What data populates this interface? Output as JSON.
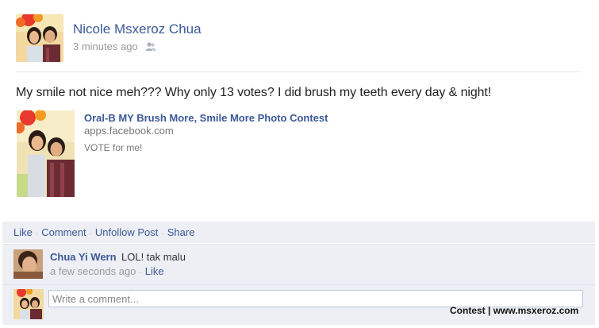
{
  "post": {
    "author": "Nicole Msxeroz Chua",
    "timestamp": "3 minutes ago",
    "privacy_icon": "friends-icon",
    "message": "My smile not nice meh??? Why only 13 votes? I did brush my teeth every day & night!"
  },
  "attachment": {
    "title": "Oral-B MY Brush More, Smile More Photo Contest",
    "domain": "apps.facebook.com",
    "description": "VOTE for me!"
  },
  "actions": {
    "like": "Like",
    "comment": "Comment",
    "unfollow": "Unfollow Post",
    "share": "Share",
    "separator": "·"
  },
  "comment": {
    "author": "Chua Yi Wern",
    "text": "LOL! tak malu",
    "timestamp": "a few seconds ago",
    "like": "Like"
  },
  "write_comment": {
    "placeholder": "Write a comment..."
  },
  "watermark": "Contest | www.msxeroz.com",
  "colors": {
    "link": "#3b5998",
    "panel": "#edeff4",
    "muted": "#999999"
  }
}
